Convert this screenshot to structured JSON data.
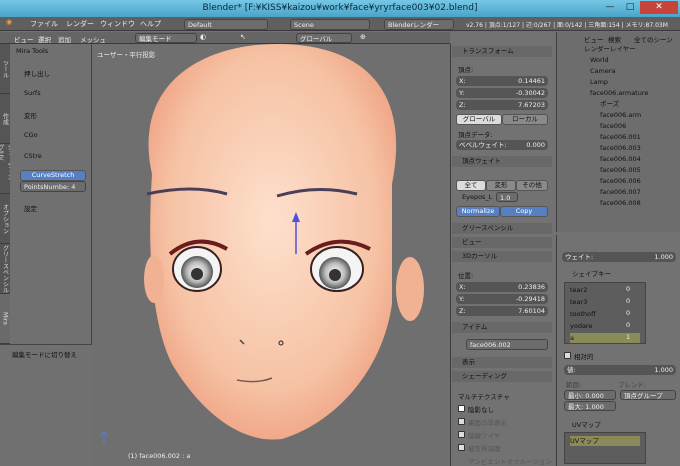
{
  "window": {
    "title": "Blender* [F:¥KISS¥kaizou¥work¥face¥yryrface003¥02.blend]",
    "minimize": "—",
    "maximize": "□",
    "close": "✕"
  },
  "menubar": {
    "file": "ファイル",
    "render": "レンダー",
    "window": "ウィンドウ",
    "help": "ヘルプ",
    "layout": "Default",
    "scene": "Scene",
    "engine": "Blenderレンダー",
    "stats": "v2.76 | 頂点:1/127 | 辺:0/267 | 面:0/142 | 三角面:154 | メモリ:87.03M"
  },
  "viewport_header": {
    "view": "ビュー",
    "select": "選択",
    "add": "追加",
    "mesh": "メッシュ",
    "mode": "編集モード",
    "orientation": "グローバル"
  },
  "viewport": {
    "label": "ユーザー・平行投影",
    "object_info": "(1) face006.002 : a"
  },
  "side_tabs": [
    "ツール",
    "作成",
    "シェーディング/UV",
    "オプション",
    "グリースペンシル",
    "Mira"
  ],
  "tool_panel": {
    "title": "Mira Tools",
    "items": [
      "押し出し",
      "Surfs",
      "変形",
      "CGo",
      "CStre"
    ],
    "curve_stretch": "CurveStretch",
    "points_number": "PointsNumbe: 4",
    "settings": "設定",
    "last_op": "編集モードに切り替え"
  },
  "npanel": {
    "transform": "トランスフォーム",
    "vertex": "頂点:",
    "x1": "0.14461",
    "y1": "-0.30042",
    "z1": "7.67203",
    "global": "グローバル",
    "local": "ローカル",
    "vertex_data": "頂点データ:",
    "bevel_weight": "ベベルウェイト:",
    "bevel_value": "0.000",
    "vertex_weights": "頂点ウェイト",
    "all": "全て",
    "deform": "変形",
    "other": "その他",
    "eyepos": "Eyepos_L",
    "eyepos_value": "1.0",
    "normalize": "Normalize",
    "copy": "Copy",
    "grease": "グリースペンシル",
    "view": "ビュー",
    "cursor": "3Dカーソル",
    "location": "位置:",
    "x2": "0.23836",
    "y2": "-0.29418",
    "z2": "7.60104",
    "item": "アイテム",
    "item_name": "face006.002",
    "display": "表示",
    "shading": "シェーディング",
    "matcap": "マルチテクスチャ",
    "hidden": "陰影なし",
    "backface": "裏面の非表示",
    "hidden_wire": "陰線ワイヤ",
    "depth": "被写界深度",
    "ao": "アンビエントオクルージョン"
  },
  "outliner": {
    "view": "ビュー",
    "search": "検索",
    "scenes": "全てのシーン",
    "rows": [
      "レンダーレイヤー",
      "World",
      "Camera",
      "Lamp",
      "face006.armature",
      "ポーズ",
      "face006.arm",
      "face006",
      "face006.001",
      "face006.003",
      "face006.004",
      "face006.005",
      "face006.006",
      "face006.007",
      "face006.008"
    ]
  },
  "properties": {
    "weight_label": "ウェイト:",
    "weight_value": "1.000",
    "shape_keys": "シェイプキー",
    "keys": [
      {
        "name": "tear2",
        "value": "0"
      },
      {
        "name": "tear3",
        "value": "0"
      },
      {
        "name": "toothoff",
        "value": "0"
      },
      {
        "name": "yodare",
        "value": "0"
      },
      {
        "name": "a",
        "value": "1"
      }
    ],
    "relative": "相対的",
    "value_label": "値:",
    "value": "1.000",
    "range": "範囲:",
    "blend": "ブレンド:",
    "min": "最小: 0.000",
    "max": "最大: 1.000",
    "vertex_group": "頂点グループ",
    "uv_maps": "UVマップ",
    "uv_map": "UVマップ"
  }
}
